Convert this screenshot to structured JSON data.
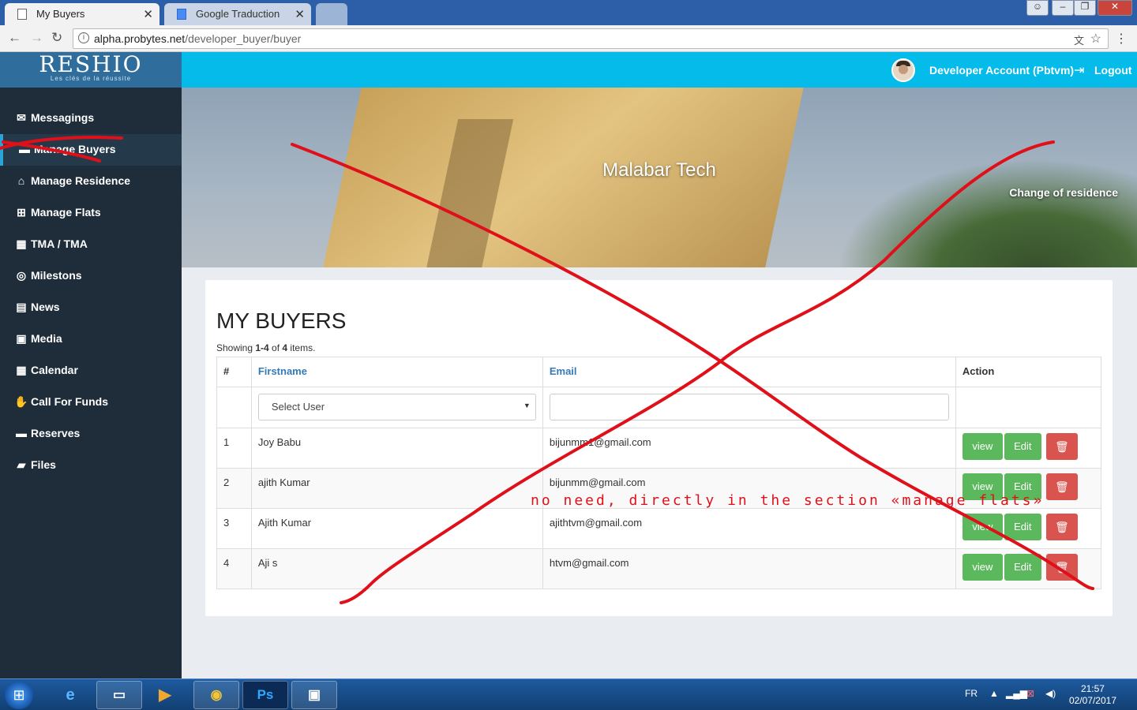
{
  "browser": {
    "tabs": [
      {
        "title": "My Buyers",
        "active": true
      },
      {
        "title": "Google Traduction",
        "active": false
      }
    ],
    "url_host": "alpha.probytes.net",
    "url_path": "/developer_buyer/buyer"
  },
  "sidebar": {
    "logo": "RESHIO",
    "logo_tagline": "Les clés de la réussite",
    "items": [
      {
        "label": "Messagings",
        "icon": "envelope-icon",
        "glyph": "✉",
        "active": false
      },
      {
        "label": "Manage Buyers",
        "icon": "id-card-icon",
        "glyph": "▬",
        "active": true
      },
      {
        "label": "Manage Residence",
        "icon": "bank-icon",
        "glyph": "⌂",
        "active": false
      },
      {
        "label": "Manage Flats",
        "icon": "grid-icon",
        "glyph": "⊞",
        "active": false
      },
      {
        "label": "TMA / TMA",
        "icon": "building-question-icon",
        "glyph": "▦",
        "active": false
      },
      {
        "label": "Milestons",
        "icon": "target-icon",
        "glyph": "◎",
        "active": false
      },
      {
        "label": "News",
        "icon": "newspaper-icon",
        "glyph": "▤",
        "active": false
      },
      {
        "label": "Media",
        "icon": "image-icon",
        "glyph": "▣",
        "active": false
      },
      {
        "label": "Calendar",
        "icon": "calendar-icon",
        "glyph": "▦",
        "active": false
      },
      {
        "label": "Call For Funds",
        "icon": "handshake-icon",
        "glyph": "✋",
        "active": false
      },
      {
        "label": "Reserves",
        "icon": "id-card-icon",
        "glyph": "▬",
        "active": false
      },
      {
        "label": "Files",
        "icon": "folder-open-icon",
        "glyph": "▰",
        "active": false
      }
    ]
  },
  "topbar": {
    "account": "Developer Account (Pbtvm)",
    "logout": "Logout"
  },
  "banner": {
    "title": "Malabar Tech",
    "change_link": "Change of residence"
  },
  "main": {
    "title": "MY BUYERS",
    "summary_prefix": "Showing ",
    "summary_range": "1-4",
    "summary_mid": " of ",
    "summary_total": "4",
    "summary_suffix": " items.",
    "columns": [
      "#",
      "Firstname",
      "Email",
      "Action"
    ],
    "filter_select_placeholder": "Select User",
    "filter_email_value": "",
    "rows": [
      {
        "num": "1",
        "firstname": "Joy Babu",
        "email": "bijunmm1@gmail.com"
      },
      {
        "num": "2",
        "firstname": "ajith Kumar",
        "email": "bijunmm@gmail.com"
      },
      {
        "num": "3",
        "firstname": "Ajith Kumar",
        "email": "ajithtvm@gmail.com"
      },
      {
        "num": "4",
        "firstname": "Aji s",
        "email": "htvm@gmail.com"
      }
    ],
    "actions": {
      "view": "view",
      "edit": "Edit",
      "delete_icon": "trash-icon"
    }
  },
  "annotation": {
    "note": "no need, directly in the section «manage flats»",
    "color": "#e0101a"
  },
  "taskbar": {
    "lang": "FR",
    "time": "21:57",
    "date": "02/07/2017",
    "apps": [
      "internet-explorer-icon",
      "file-explorer-icon",
      "media-player-icon",
      "chrome-icon",
      "photoshop-icon",
      "image-viewer-icon"
    ],
    "photoshop_label": "Ps"
  }
}
